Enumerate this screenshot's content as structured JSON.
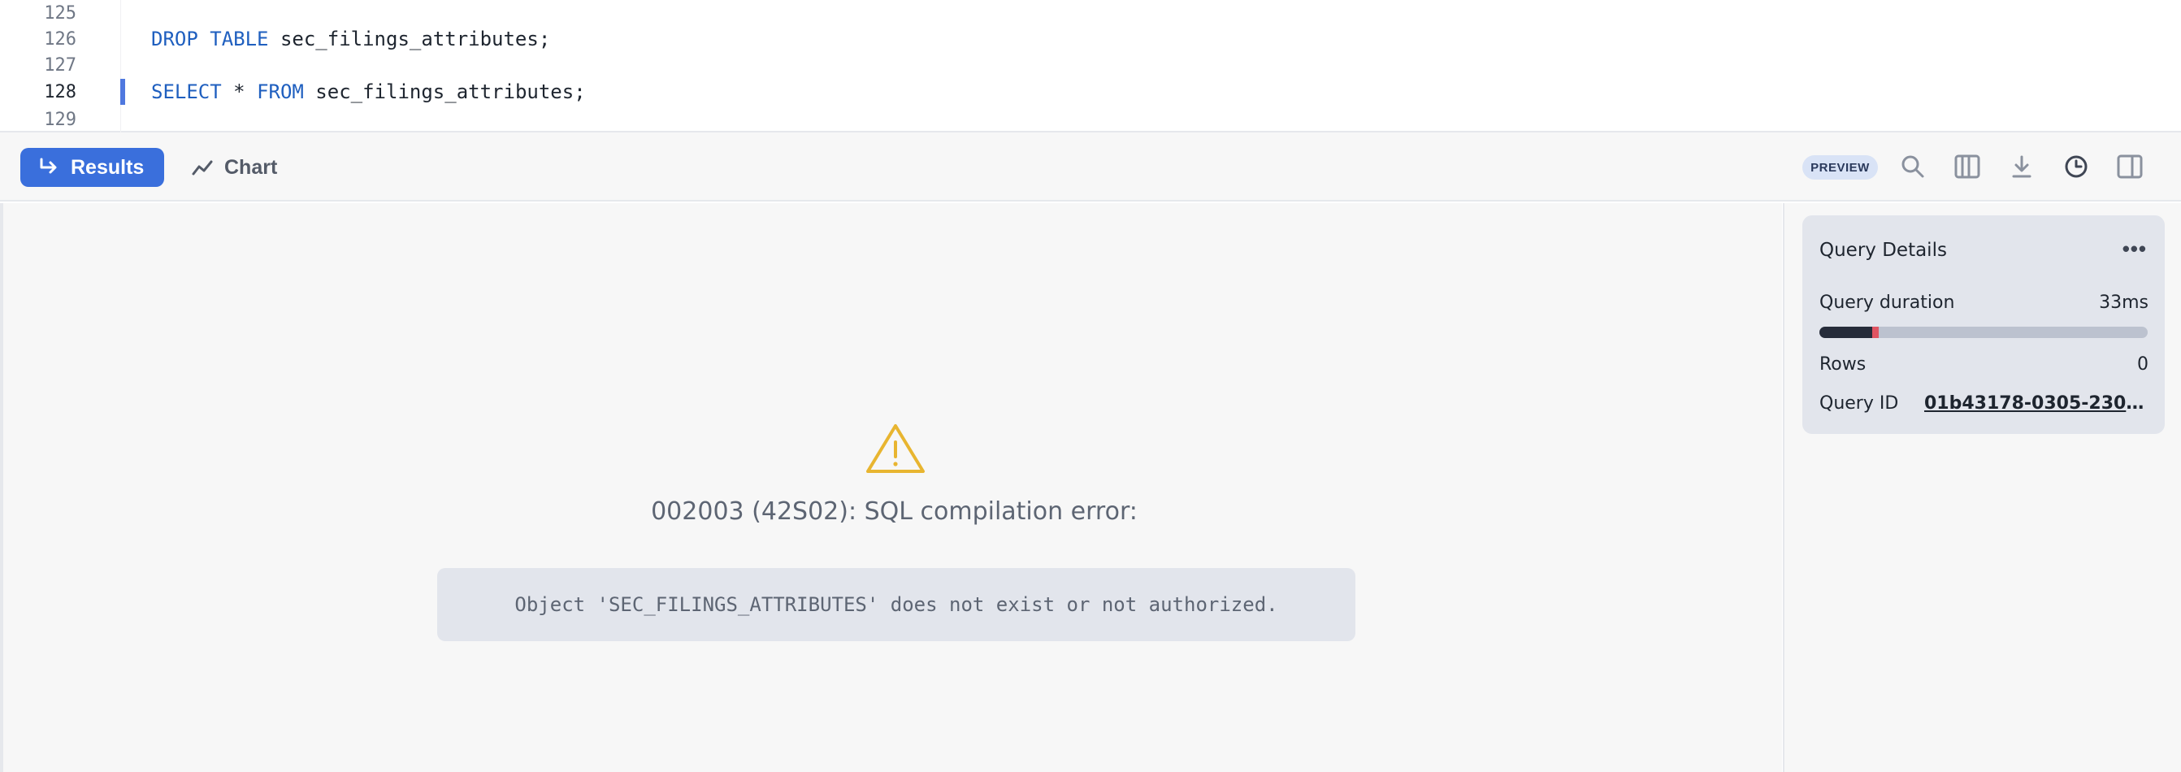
{
  "editor": {
    "lines": [
      {
        "num": "125",
        "keywords": "",
        "rest": ""
      },
      {
        "num": "126",
        "keywords": "DROP TABLE",
        "rest": " sec_filings_attributes;"
      },
      {
        "num": "127",
        "keywords": "",
        "rest": ""
      },
      {
        "num": "128",
        "keywords": "SELECT",
        "mid": " * ",
        "keyword2": "FROM",
        "rest": " sec_filings_attributes;"
      },
      {
        "num": "129",
        "keywords": "",
        "rest": ""
      }
    ],
    "active_line": "128"
  },
  "toolbar": {
    "results_label": "Results",
    "chart_label": "Chart",
    "preview_badge": "PREVIEW",
    "icons": [
      "search-icon",
      "columns-icon",
      "download-icon",
      "history-clock-icon",
      "panel-toggle-icon"
    ]
  },
  "error": {
    "title": "002003 (42S02): SQL compilation error:",
    "message": "Object 'SEC_FILINGS_ATTRIBUTES' does not exist or not authorized."
  },
  "query_details": {
    "title": "Query Details",
    "duration_label": "Query duration",
    "duration_value": "33ms",
    "duration_progress": 0.18,
    "rows_label": "Rows",
    "rows_value": "0",
    "id_label": "Query ID",
    "id_value": "01b43178-0305-2304-..."
  },
  "colors": {
    "accent": "#3a6fdc",
    "warning": "#e8b530",
    "error_marker": "#e05462"
  }
}
